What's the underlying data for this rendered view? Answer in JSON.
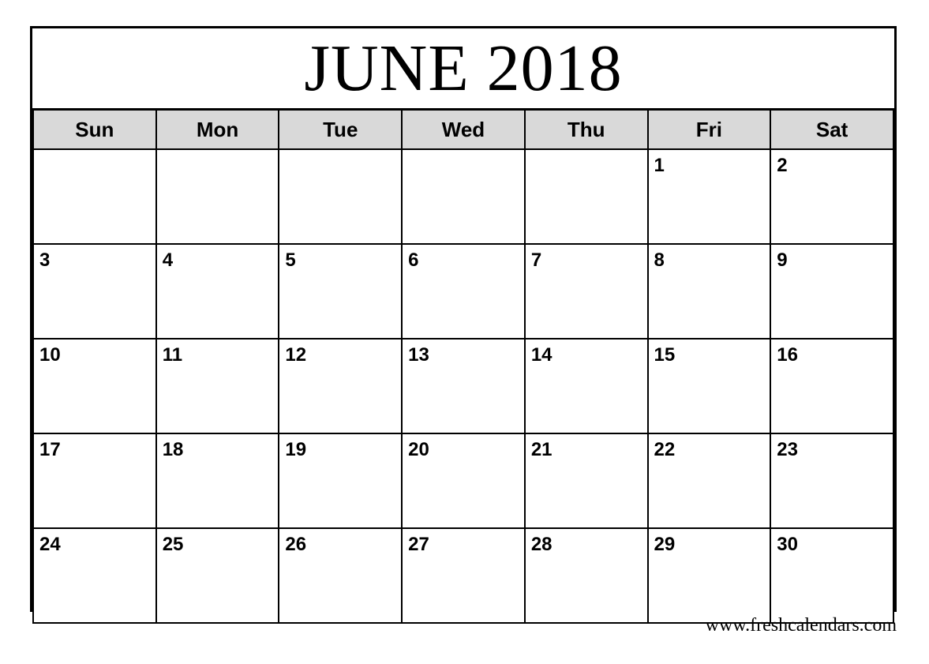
{
  "calendar": {
    "title": "JUNE 2018",
    "month": "JUNE",
    "year": "2018",
    "weekdays": [
      {
        "short": "Sun",
        "name": "sunday"
      },
      {
        "short": "Mon",
        "name": "monday"
      },
      {
        "short": "Tue",
        "name": "tuesday"
      },
      {
        "short": "Wed",
        "name": "wednesday"
      },
      {
        "short": "Thu",
        "name": "thursday"
      },
      {
        "short": "Fri",
        "name": "friday"
      },
      {
        "short": "Sat",
        "name": "saturday"
      }
    ],
    "weeks": [
      [
        "",
        "",
        "",
        "",
        "",
        "1",
        "2"
      ],
      [
        "3",
        "4",
        "5",
        "6",
        "7",
        "8",
        "9"
      ],
      [
        "10",
        "11",
        "12",
        "13",
        "14",
        "15",
        "16"
      ],
      [
        "17",
        "18",
        "19",
        "20",
        "21",
        "22",
        "23"
      ],
      [
        "24",
        "25",
        "26",
        "27",
        "28",
        "29",
        "30"
      ]
    ],
    "footer_credit": "www.freshcalendars.com",
    "colors": {
      "border": "#000000",
      "weekday_header_background": "#d9d9d9",
      "cell_background": "#ffffff",
      "text": "#000000",
      "page_background": "#ffffff"
    }
  }
}
